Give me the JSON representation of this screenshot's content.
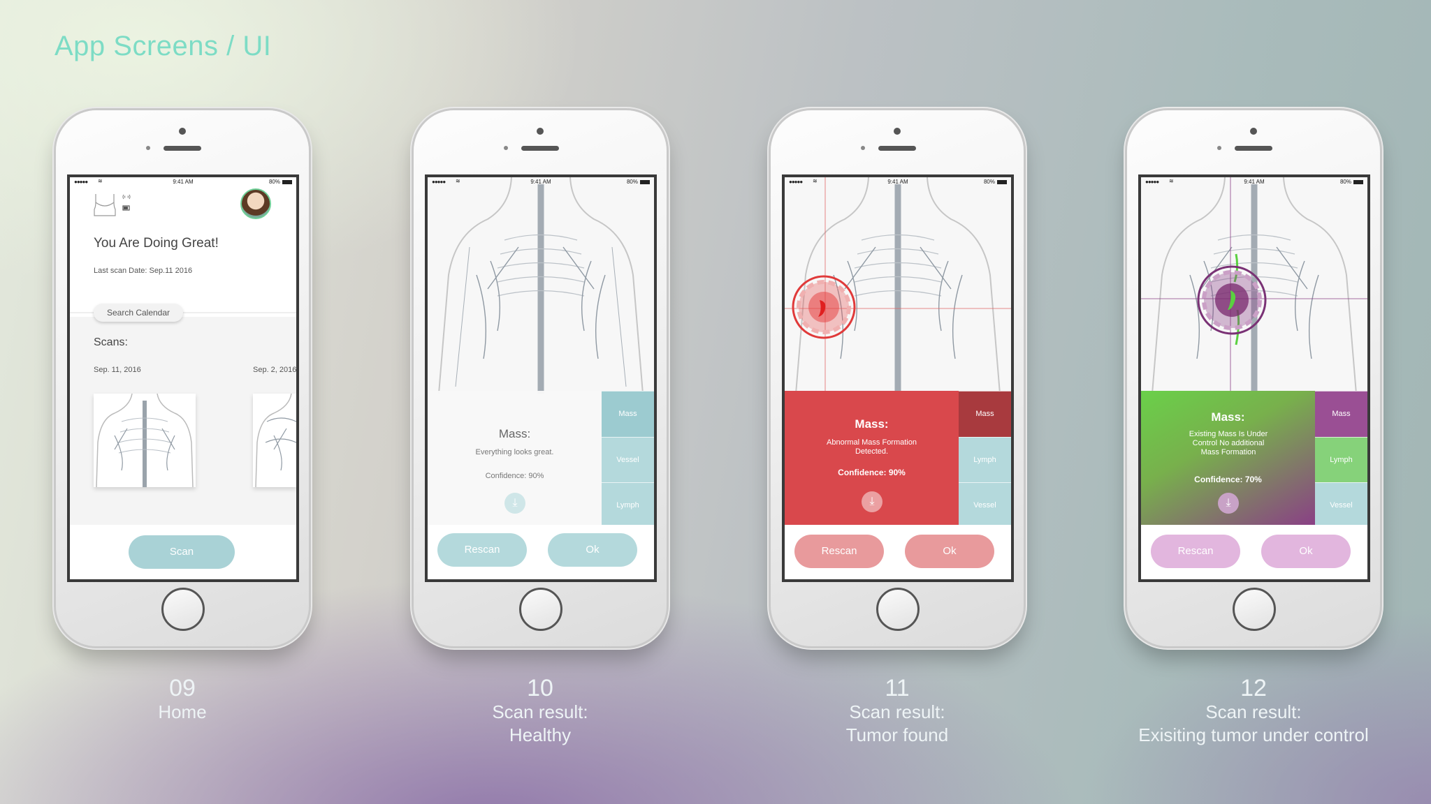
{
  "page": {
    "title": "App Screens / UI"
  },
  "status_bar": {
    "signal": "●●●●●",
    "wifi": "≋",
    "time": "9:41 AM",
    "battery": "80%"
  },
  "screens": [
    {
      "number": "09",
      "caption": "Home",
      "greeting": "You Are Doing Great!",
      "last_scan": "Last scan Date: Sep.11 2016",
      "search_calendar": "Search Calendar",
      "scans_label": "Scans:",
      "scan_dates": [
        "Sep. 11, 2016",
        "Sep. 2, 2016"
      ],
      "scan_button": "Scan"
    },
    {
      "number": "10",
      "caption_line1": "Scan result:",
      "caption_line2": "Healthy",
      "mass_title": "Mass:",
      "mass_text": "Everything looks great.",
      "confidence": "Confidence: 90%",
      "tabs": [
        "Mass",
        "Vessel",
        "Lymph"
      ],
      "rescan": "Rescan",
      "ok": "Ok"
    },
    {
      "number": "11",
      "caption_line1": "Scan result:",
      "caption_line2": "Tumor found",
      "mass_title": "Mass:",
      "mass_text": "Abnormal Mass Formation Detected.",
      "confidence": "Confidence: 90%",
      "tabs": [
        "Mass",
        "Lymph",
        "Vessel"
      ],
      "rescan": "Rescan",
      "ok": "Ok"
    },
    {
      "number": "12",
      "caption_line1": "Scan result:",
      "caption_line2": "Exisiting tumor under control",
      "mass_title": "Mass:",
      "mass_text": "Existing Mass Is Under Control No additional Mass Formation",
      "confidence": "Confidence: 70%",
      "tabs": [
        "Mass",
        "Lymph",
        "Vessel"
      ],
      "rescan": "Rescan",
      "ok": "Ok"
    }
  ],
  "colors": {
    "title": "#7ddcc5",
    "healthy_tab": "#a9d2d6",
    "tumor_panel": "#d9484c",
    "tumor_button": "#e89a9c",
    "control_green": "#6ad04a",
    "control_purple": "#8a3f86",
    "control_button": "#e2b6de"
  }
}
